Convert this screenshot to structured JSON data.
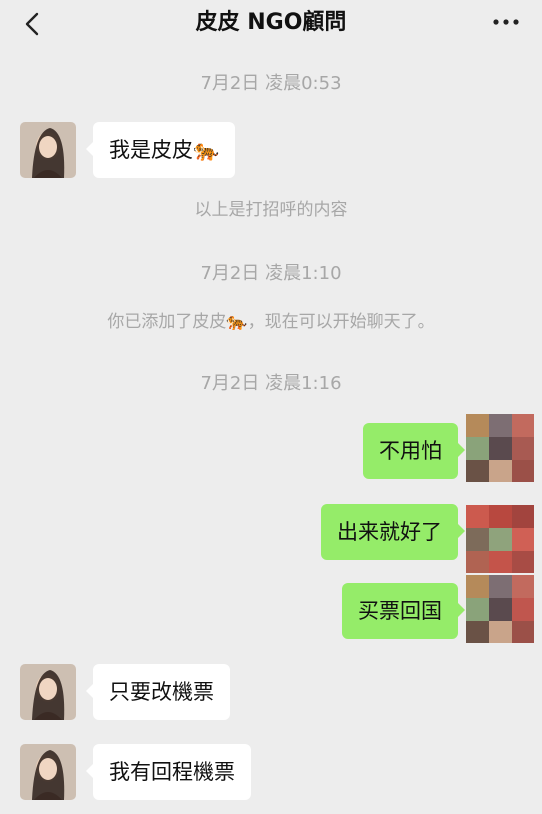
{
  "header": {
    "title": "皮皮 NGO顧問",
    "back_icon": "chevron-left-icon",
    "more_icon": "more-icon"
  },
  "timestamps": [
    "7月2日 凌晨0:53",
    "7月2日 凌晨1:10",
    "7月2日 凌晨1:16"
  ],
  "system": {
    "greeting_note": "以上是打招呼的内容",
    "added_note": "你已添加了皮皮🐅，现在可以开始聊天了。"
  },
  "messages": [
    {
      "side": "in",
      "text": "我是皮皮🐅"
    },
    {
      "side": "out",
      "text": "不用怕"
    },
    {
      "side": "out",
      "text": "出来就好了"
    },
    {
      "side": "out",
      "text": "买票回国"
    },
    {
      "side": "in",
      "text": "只要改機票"
    },
    {
      "side": "in",
      "text": "我有回程機票"
    }
  ],
  "colors": {
    "background": "#ededed",
    "incoming_bubble": "#ffffff",
    "outgoing_bubble": "#95ec69",
    "meta_text": "#a7a7a7"
  }
}
